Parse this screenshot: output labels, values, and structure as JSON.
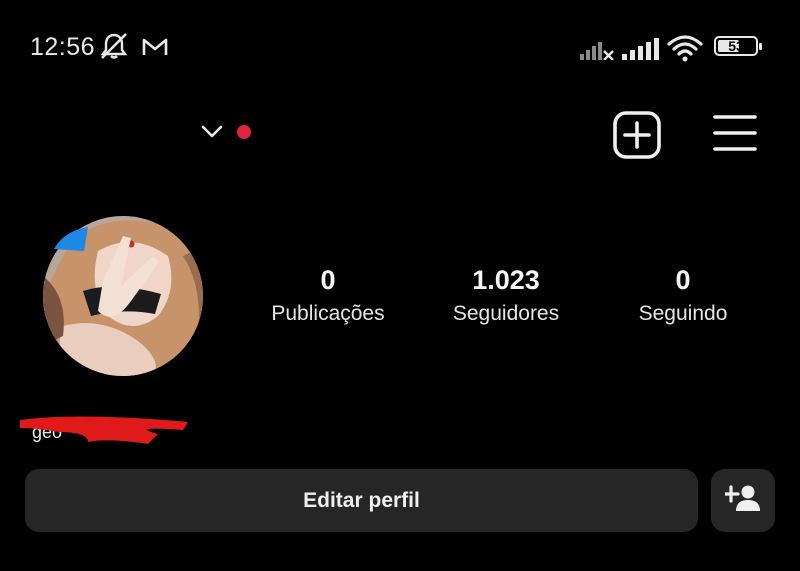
{
  "status_bar": {
    "time": "12:56",
    "battery": "53",
    "icons": [
      "mute-icon",
      "gmail-icon",
      "signal-icon-1",
      "signal-icon-2",
      "wifi-icon",
      "battery-icon"
    ]
  },
  "header": {
    "username": "",
    "icons": [
      "chevron-down-icon",
      "new-post-icon",
      "menu-icon"
    ],
    "notification_color": "#e0243c"
  },
  "profile": {
    "stats": [
      {
        "value": "0",
        "label": "Publicações"
      },
      {
        "value": "1.023",
        "label": "Seguidores"
      },
      {
        "value": "0",
        "label": "Seguindo"
      }
    ],
    "display_name": "geo"
  },
  "actions": {
    "edit_label": "Editar perfil",
    "add_user_icon": "add-user-icon"
  },
  "colors": {
    "background": "#000000",
    "button": "#262626",
    "redaction": "#e01a1a",
    "story_accent": "#1e88e5"
  }
}
